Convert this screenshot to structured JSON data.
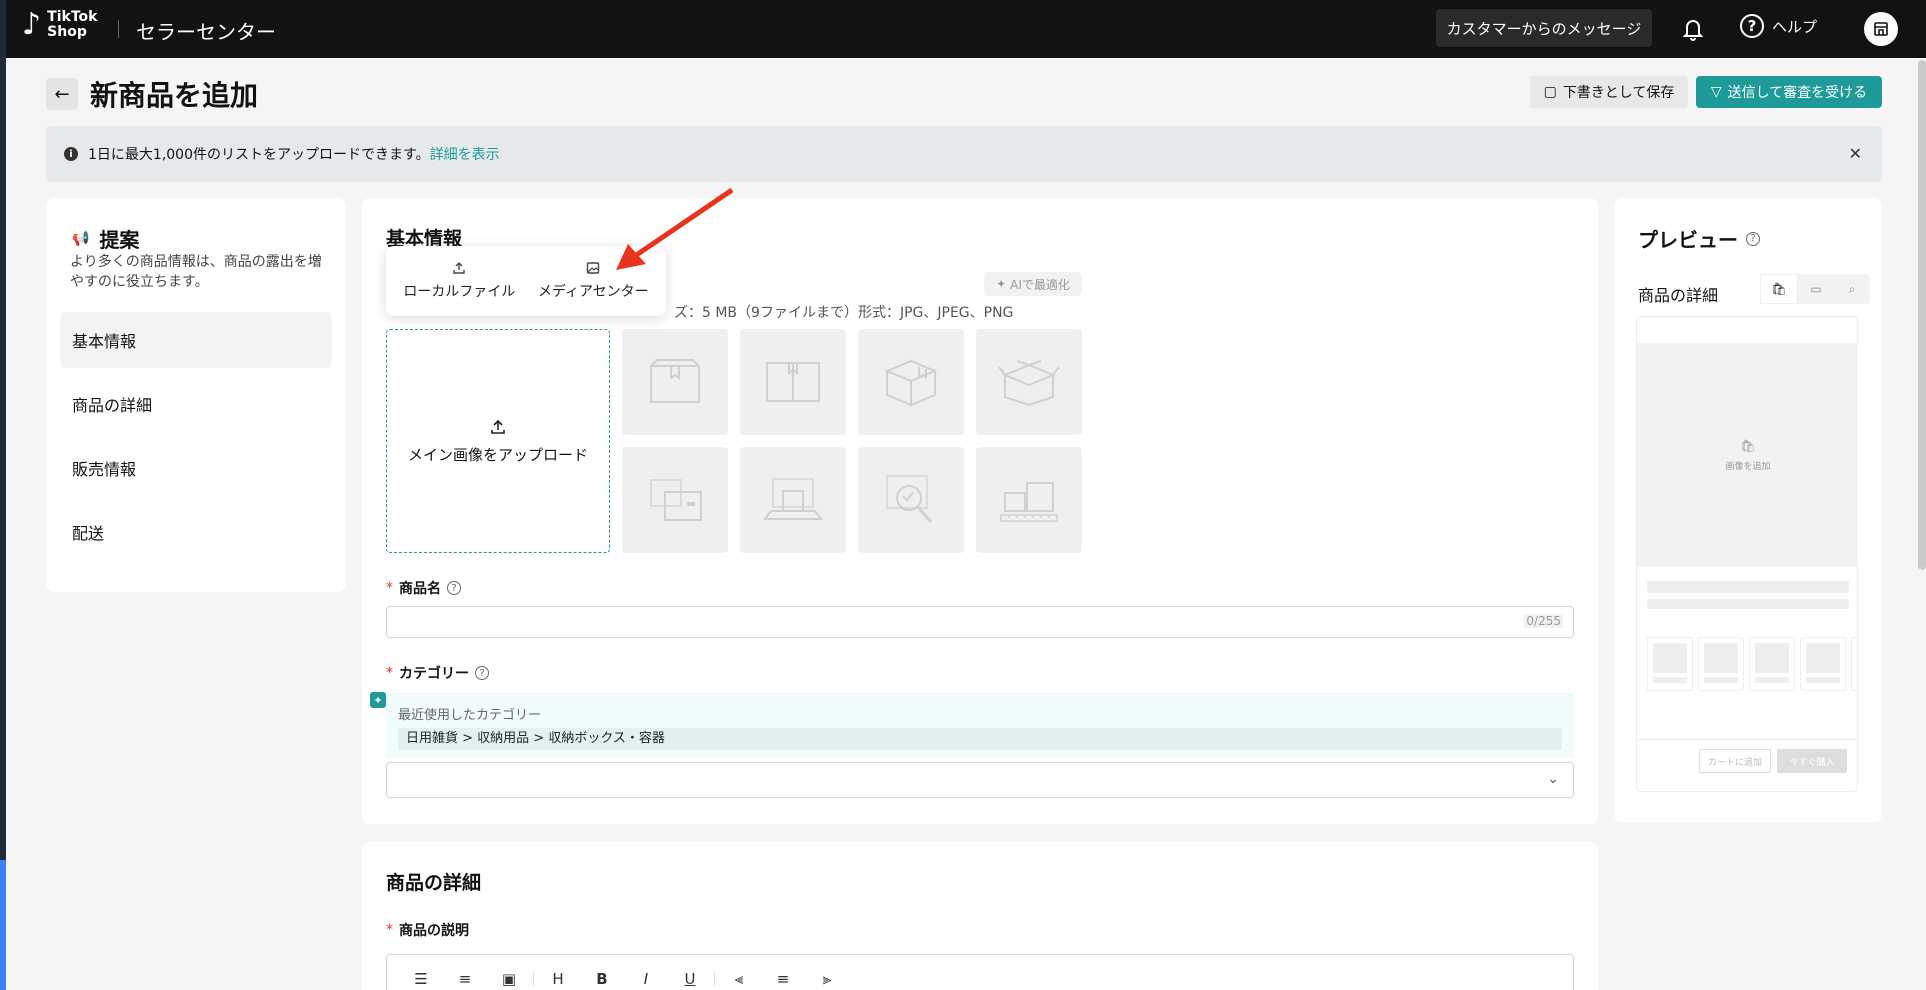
{
  "app": {
    "brand_line1": "TikTok",
    "brand_line2": "Shop",
    "center_title": "セラーセンター"
  },
  "topbar": {
    "messages_label": "カスタマーからのメッセージ",
    "help_label": "ヘルプ"
  },
  "page": {
    "title": "新商品を追加",
    "draft_label": "下書きとして保存",
    "submit_label": "送信して審査を受ける"
  },
  "banner": {
    "text": "1日に最大1,000件のリストをアップロードできます。",
    "link": "詳細を表示"
  },
  "suggestions": {
    "title": "提案",
    "description": "より多くの商品情報は、商品の露出を増やすのに役立ちます。",
    "nav": [
      "基本情報",
      "商品の詳細",
      "販売情報",
      "配送"
    ]
  },
  "basic": {
    "title": "基本情報",
    "popover": {
      "local": "ローカルファイル",
      "media": "メディアセンター"
    },
    "ai_label": "AIで最適化",
    "image_hint": "ズ：5 MB（9ファイルまで）形式：JPG、JPEG、PNG",
    "upload_label": "メイン画像をアップロード",
    "name_label": "商品名",
    "name_counter": "0/255",
    "category_label": "カテゴリー",
    "recent_label": "最近使用したカテゴリー",
    "recent_value": "日用雑貨 > 収納用品 > 収納ボックス・容器"
  },
  "details": {
    "title": "商品の詳細",
    "desc_label": "商品の説明"
  },
  "editor": {
    "heading": "H",
    "bold": "B",
    "italic": "I",
    "underline": "U"
  },
  "preview": {
    "title": "プレビュー",
    "subtitle": "商品の詳細",
    "add_image": "画像を追加",
    "cart": "カートに追加",
    "buy": "今すぐ購入"
  },
  "colors": {
    "accent": "#1e9a98",
    "topbar": "#121212",
    "required": "#e0352b",
    "annotation_arrow": "#e8341c"
  },
  "icons": [
    "tiktok-logo-icon",
    "bell-icon",
    "help-icon",
    "store-icon",
    "back-arrow-icon",
    "save-icon",
    "filter-icon",
    "info-icon",
    "close-icon",
    "megaphone-icon",
    "upload-icon",
    "image-icon",
    "sparkle-icon",
    "chevron-down-icon",
    "list-bullet-icon",
    "list-number-icon",
    "align-left-icon",
    "align-center-icon",
    "align-right-icon"
  ]
}
